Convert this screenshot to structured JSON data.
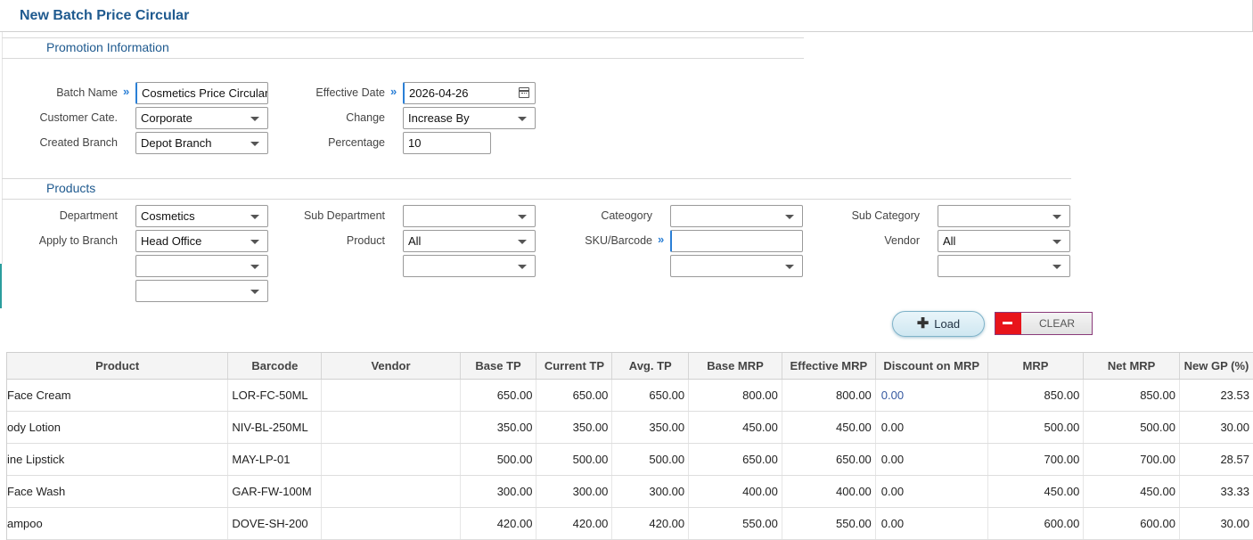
{
  "page": {
    "title": "New Batch Price Circular"
  },
  "promotion": {
    "section_title": "Promotion Information",
    "batch_name": {
      "label": "Batch Name",
      "value": "Cosmetics Price Circular"
    },
    "customer_cate": {
      "label": "Customer Cate.",
      "value": "Corporate"
    },
    "created_branch": {
      "label": "Created Branch",
      "value": "Depot Branch"
    },
    "effective_date": {
      "label": "Effective Date",
      "value": "2026-04-26"
    },
    "change": {
      "label": "Change",
      "value": "Increase By"
    },
    "percentage": {
      "label": "Percentage",
      "value": "10"
    }
  },
  "products": {
    "section_title": "Products",
    "department": {
      "label": "Department",
      "value": "Cosmetics"
    },
    "apply_to_branch": {
      "label": "Apply to Branch",
      "value": "Head Office"
    },
    "sub_department": {
      "label": "Sub Department",
      "value": ""
    },
    "product": {
      "label": "Product",
      "value": "All"
    },
    "category": {
      "label": "Cateogory",
      "value": ""
    },
    "sku_barcode": {
      "label": "SKU/Barcode",
      "value": ""
    },
    "sub_category": {
      "label": "Sub Category",
      "value": ""
    },
    "vendor": {
      "label": "Vendor",
      "value": "All"
    }
  },
  "actions": {
    "load_label": "Load",
    "clear_label": "CLEAR"
  },
  "grid": {
    "columns": [
      "Product",
      "Barcode",
      "Vendor",
      "Base TP",
      "Current TP",
      "Avg. TP",
      "Base MRP",
      "Effective MRP",
      "Discount on MRP",
      "MRP",
      "Net MRP",
      "New GP (%)"
    ],
    "rows": [
      [
        "Face Cream",
        "LOR-FC-50ML",
        "",
        "650.00",
        "650.00",
        "650.00",
        "800.00",
        "800.00",
        "0.00",
        "850.00",
        "850.00",
        "23.53"
      ],
      [
        "ody Lotion",
        "NIV-BL-250ML",
        "",
        "350.00",
        "350.00",
        "350.00",
        "450.00",
        "450.00",
        "0.00",
        "500.00",
        "500.00",
        "30.00"
      ],
      [
        "ine Lipstick",
        "MAY-LP-01",
        "",
        "500.00",
        "500.00",
        "500.00",
        "650.00",
        "650.00",
        "0.00",
        "700.00",
        "700.00",
        "28.57"
      ],
      [
        "Face Wash",
        "GAR-FW-100M",
        "",
        "300.00",
        "300.00",
        "300.00",
        "400.00",
        "400.00",
        "0.00",
        "450.00",
        "450.00",
        "33.33"
      ],
      [
        "ampoo",
        "DOVE-SH-200",
        "",
        "420.00",
        "420.00",
        "420.00",
        "550.00",
        "550.00",
        "0.00",
        "600.00",
        "600.00",
        "30.00"
      ]
    ]
  },
  "colors": {
    "accent": "#1f5a8f",
    "focus": "#2a7fd6",
    "clear_red": "#e8141b"
  },
  "icons": {
    "focus_marker": "double-chevron-right-icon",
    "date_picker": "calendar-icon",
    "dropdown": "caret-down-icon",
    "load": "plus-icon",
    "clear": "minus-icon"
  }
}
